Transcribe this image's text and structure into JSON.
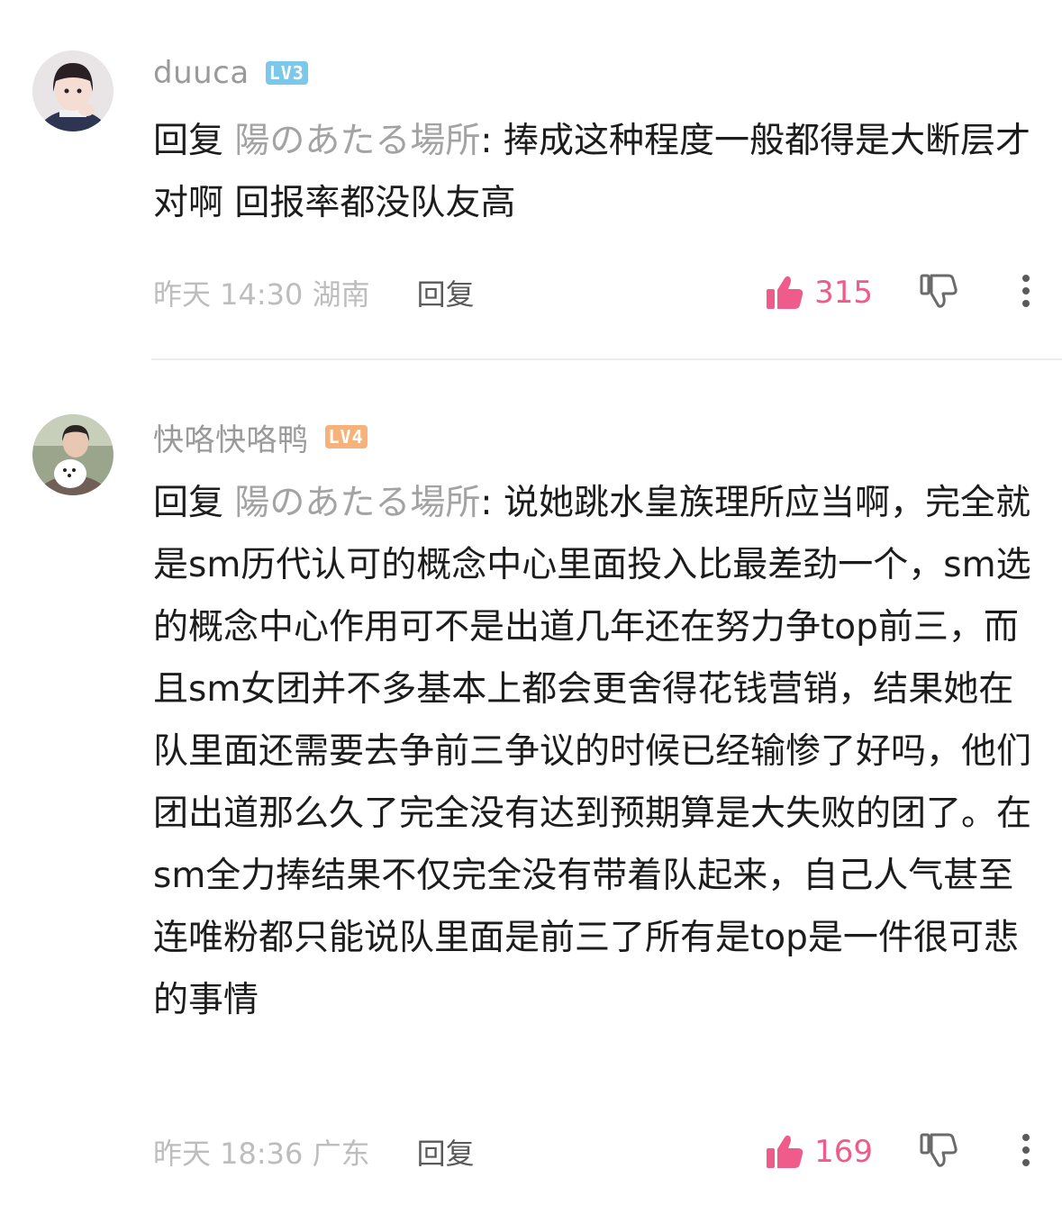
{
  "accent_like_color": "#ef5b8a",
  "comments": [
    {
      "username": "duuca",
      "level": "LV3",
      "level_color": "#7cc8ea",
      "reply_prefix": "回复 ",
      "reply_target": "陽のあたる場所",
      "text": ": 捧成这种程度一般都得是大断层才对啊 回报率都没队友高",
      "meta": "昨天 14:30 湖南",
      "reply_label": "回复",
      "likes": "315"
    },
    {
      "username": "快咯快咯鸭",
      "level": "LV4",
      "level_color": "#f5b27a",
      "reply_prefix": "回复 ",
      "reply_target": "陽のあたる場所",
      "text": ": 说她跳水皇族理所应当啊，完全就是sm历代认可的概念中心里面投入比最差劲一个，sm选的概念中心作用可不是出道几年还在努力争top前三，而且sm女团并不多基本上都会更舍得花钱营销，结果她在队里面还需要去争前三争议的时候已经输惨了好吗，他们团出道那么久了完全没有达到预期算是大失败的团了。在sm全力捧结果不仅完全没有带着队起来，自己人气甚至连唯粉都只能说队里面是前三了所有是top是一件很可悲的事情",
      "meta": "昨天 18:36 广东",
      "reply_label": "回复",
      "likes": "169"
    }
  ]
}
